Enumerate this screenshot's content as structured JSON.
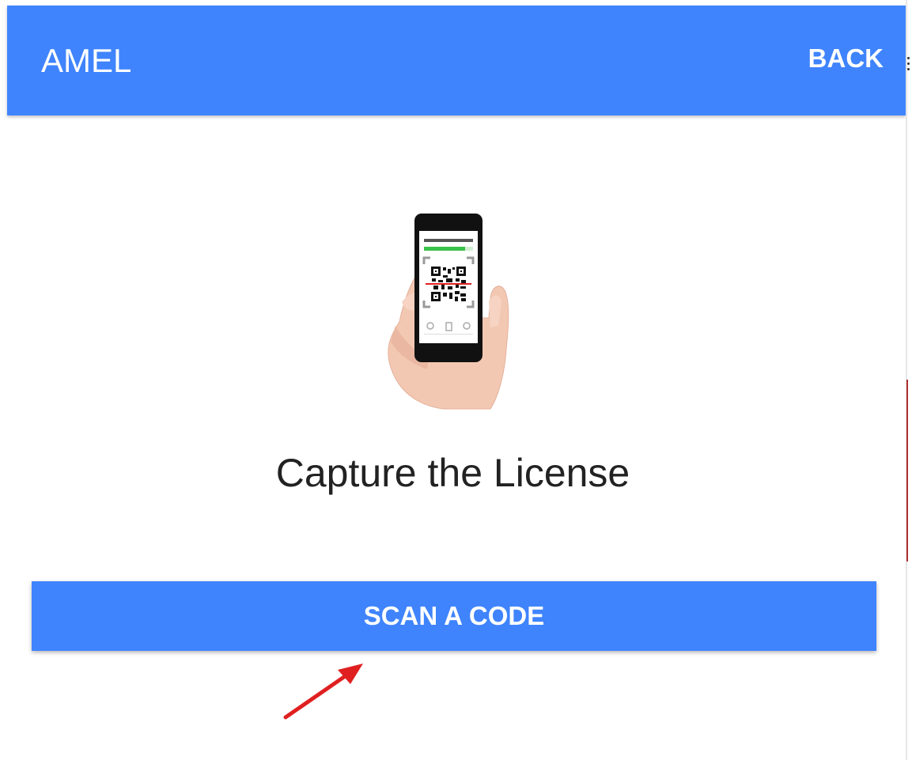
{
  "appbar": {
    "title": "AMEL",
    "back_label": "BACK",
    "color": "#3f84fd"
  },
  "illustration": {
    "icon": "hand-phone-qr-scan-icon",
    "phone_screen_text": "Scanning QR Code"
  },
  "main": {
    "heading": "Capture the License",
    "scan_button_label": "SCAN A CODE"
  },
  "annotation": {
    "icon": "red-arrow-icon",
    "color": "#e02020"
  }
}
